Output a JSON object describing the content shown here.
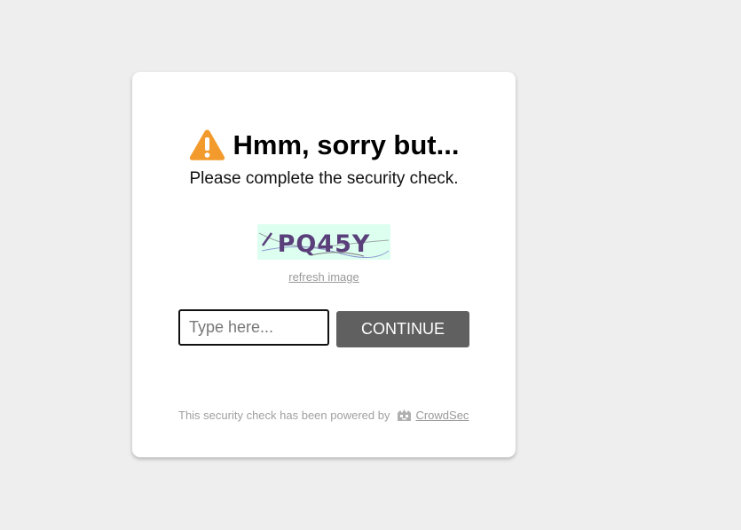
{
  "card": {
    "title": "Hmm, sorry but...",
    "subtitle": "Please complete the security check."
  },
  "captcha": {
    "text": "PQ45Y",
    "refresh_label": "refresh image"
  },
  "form": {
    "input_placeholder": "Type here...",
    "input_value": "",
    "continue_label": "CONTINUE"
  },
  "footer": {
    "powered_text": "This security check has been powered by",
    "brand_link": "CrowdSec"
  },
  "colors": {
    "page_background": "#eeeeee",
    "warning_icon": "#f39a2c",
    "button_background": "#606060",
    "captcha_background": "#ddfff0",
    "captcha_text": "#5a3f7a"
  },
  "icons": {
    "title_icon": "warning-triangle-icon",
    "brand_icon": "crowdsec-logo-icon"
  }
}
